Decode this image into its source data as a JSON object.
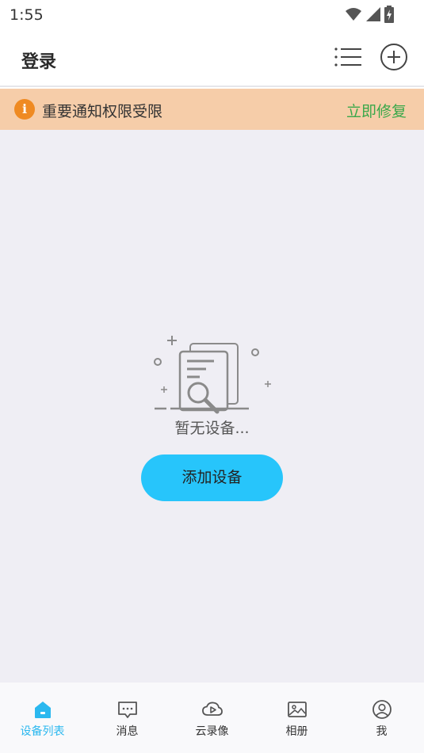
{
  "status_bar": {
    "time": "1:55"
  },
  "header": {
    "title": "登录"
  },
  "notice": {
    "icon_glyph": "i",
    "text": "重要通知权限受限",
    "action": "立即修复"
  },
  "empty_state": {
    "text": "暂无设备...",
    "button_label": "添加设备"
  },
  "tabs": [
    {
      "label": "设备列表",
      "icon": "home-icon",
      "active": true
    },
    {
      "label": "消息",
      "icon": "message-icon",
      "active": false
    },
    {
      "label": "云录像",
      "icon": "cloud-play-icon",
      "active": false
    },
    {
      "label": "相册",
      "icon": "photo-icon",
      "active": false
    },
    {
      "label": "我",
      "icon": "profile-icon",
      "active": false
    }
  ],
  "colors": {
    "accent": "#27c5fb",
    "active_tab": "#2bb8ef",
    "notice_bg": "#f6cda9",
    "notice_icon": "#ef8a22",
    "notice_action": "#3aa84a",
    "page_bg": "#efeef4"
  }
}
